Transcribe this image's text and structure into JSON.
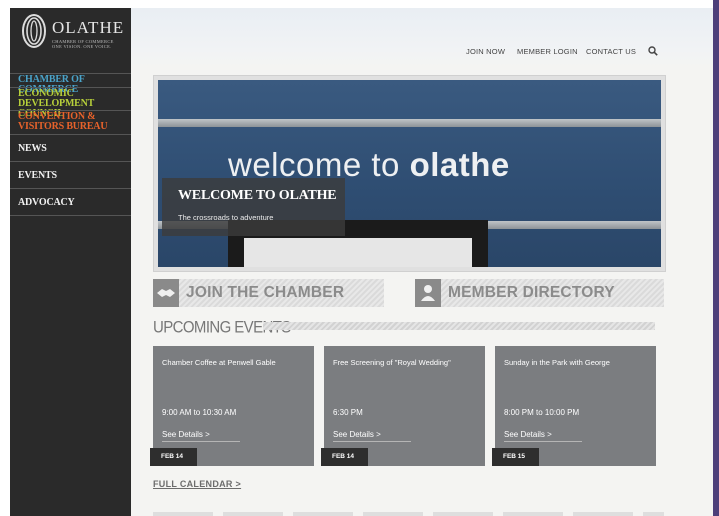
{
  "brand": {
    "name": "OLATHE",
    "sub_line1": "CHAMBER OF COMMERCE",
    "sub_line2": "ONE VISION. ONE VOICE."
  },
  "org_links": [
    {
      "label": "CHAMBER OF COMMERCE",
      "color": "#4aa3c9"
    },
    {
      "label": "ECONOMIC DEVELOPMENT COUNCIL",
      "color": "#b7cf3a"
    },
    {
      "label": "CONVENTION & VISITORS BUREAU",
      "color": "#e8622a"
    }
  ],
  "nav": [
    {
      "label": "NEWS"
    },
    {
      "label": "EVENTS"
    },
    {
      "label": "ADVOCACY"
    }
  ],
  "topnav": {
    "join": "JOIN NOW",
    "login": "MEMBER LOGIN",
    "contact": "CONTACT US",
    "search_icon": "search-icon"
  },
  "hero": {
    "sign_prefix": "welcome to ",
    "sign_bold": "olathe",
    "title": "WELCOME TO OLATHE",
    "subtitle": "The crossroads to adventure",
    "slide_count": 6,
    "active_slide": 5
  },
  "cta": {
    "join": {
      "label": "JOIN THE CHAMBER",
      "icon": "handshake-icon"
    },
    "directory": {
      "label": "MEMBER DIRECTORY",
      "icon": "person-icon"
    }
  },
  "events_section": {
    "title": "UPCOMING EVENTS",
    "items": [
      {
        "title": "Chamber Coffee at Penwell Gable",
        "time": "9:00 AM to 10:30 AM",
        "details": "See Details >",
        "date": "FEB 14"
      },
      {
        "title": "Free Screening of \"Royal Wedding\"",
        "time": "6:30 PM",
        "details": "See Details >",
        "date": "FEB 14"
      },
      {
        "title": "Sunday in the Park with George",
        "time": "8:00 PM to 10:00 PM",
        "details": "See Details >",
        "date": "FEB 15"
      }
    ],
    "full_calendar": "FULL CALENDAR >"
  },
  "colors": {
    "sidebar_bg": "#2a2a2a",
    "event_card": "#7b7d80",
    "date_badge": "#2e2e2e",
    "frame_accent": "#4d3f7a"
  }
}
